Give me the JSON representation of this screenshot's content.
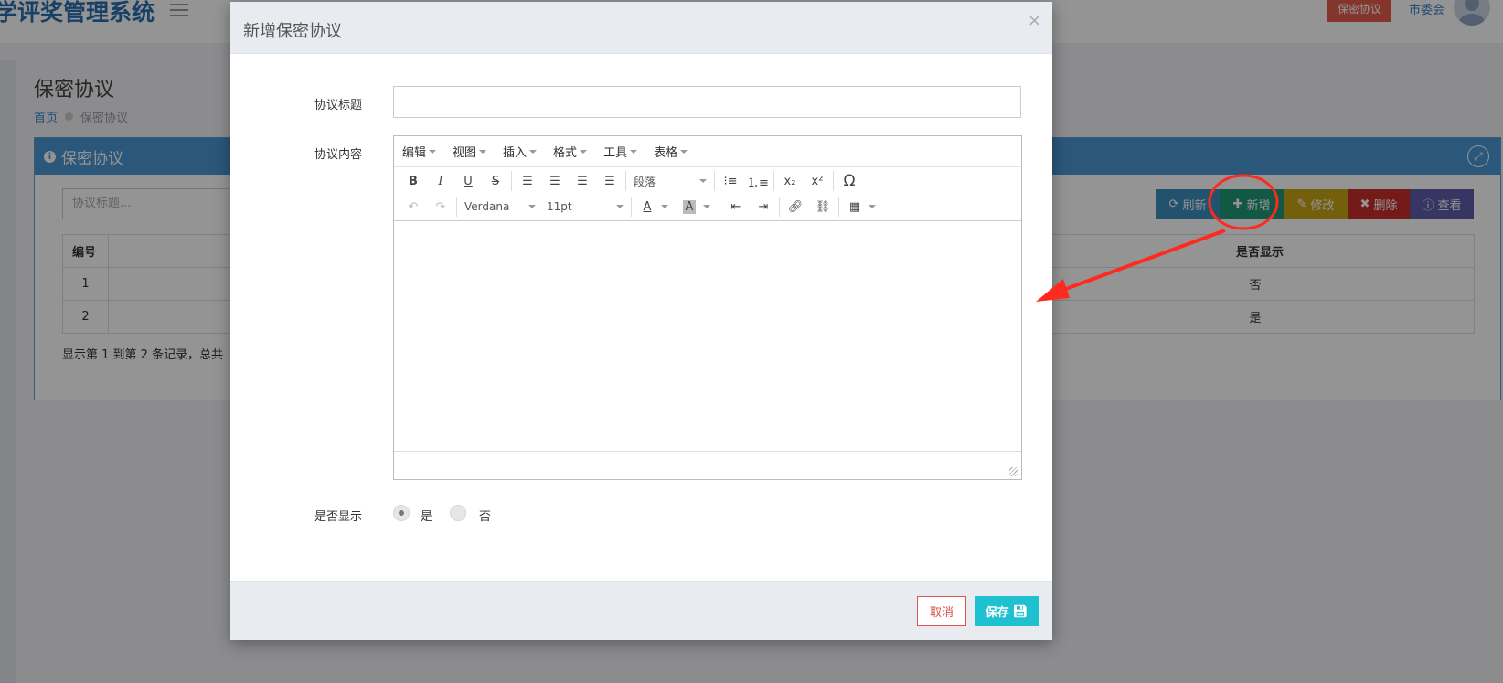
{
  "header": {
    "app_title": "学评奖管理系统",
    "badge": "保密协议",
    "user": "市委会"
  },
  "page": {
    "title": "保密协议",
    "breadcrumb": {
      "home": "首页",
      "current": "保密协议"
    }
  },
  "panel": {
    "title": "保密协议",
    "search_placeholder": "协议标题...",
    "buttons": {
      "refresh": "刷新",
      "add": "新增",
      "edit": "修改",
      "delete": "删除",
      "view": "查看"
    },
    "table": {
      "columns": [
        "编号",
        "是否显示"
      ],
      "rows": [
        {
          "id": "1",
          "show": "否"
        },
        {
          "id": "2",
          "show": "是"
        }
      ]
    },
    "pager_text": "显示第 1 到第 2 条记录，总共"
  },
  "modal": {
    "title": "新增保密协议",
    "close": "×",
    "fields": {
      "title_label": "协议标题",
      "title_value": "",
      "content_label": "协议内容",
      "show_label": "是否显示"
    },
    "editor": {
      "menus": [
        "编辑",
        "视图",
        "插入",
        "格式",
        "工具",
        "表格"
      ],
      "block_format": "段落",
      "font_family": "Verdana",
      "font_size": "11pt"
    },
    "radio": {
      "yes": "是",
      "no": "否",
      "selected": "是"
    },
    "footer": {
      "cancel": "取消",
      "save": "保存"
    }
  },
  "colors": {
    "primary": "#4a97d2",
    "add": "#1e9a78",
    "danger": "#c9302c",
    "save": "#1fc0cf",
    "annotation": "#ff2a1f"
  }
}
